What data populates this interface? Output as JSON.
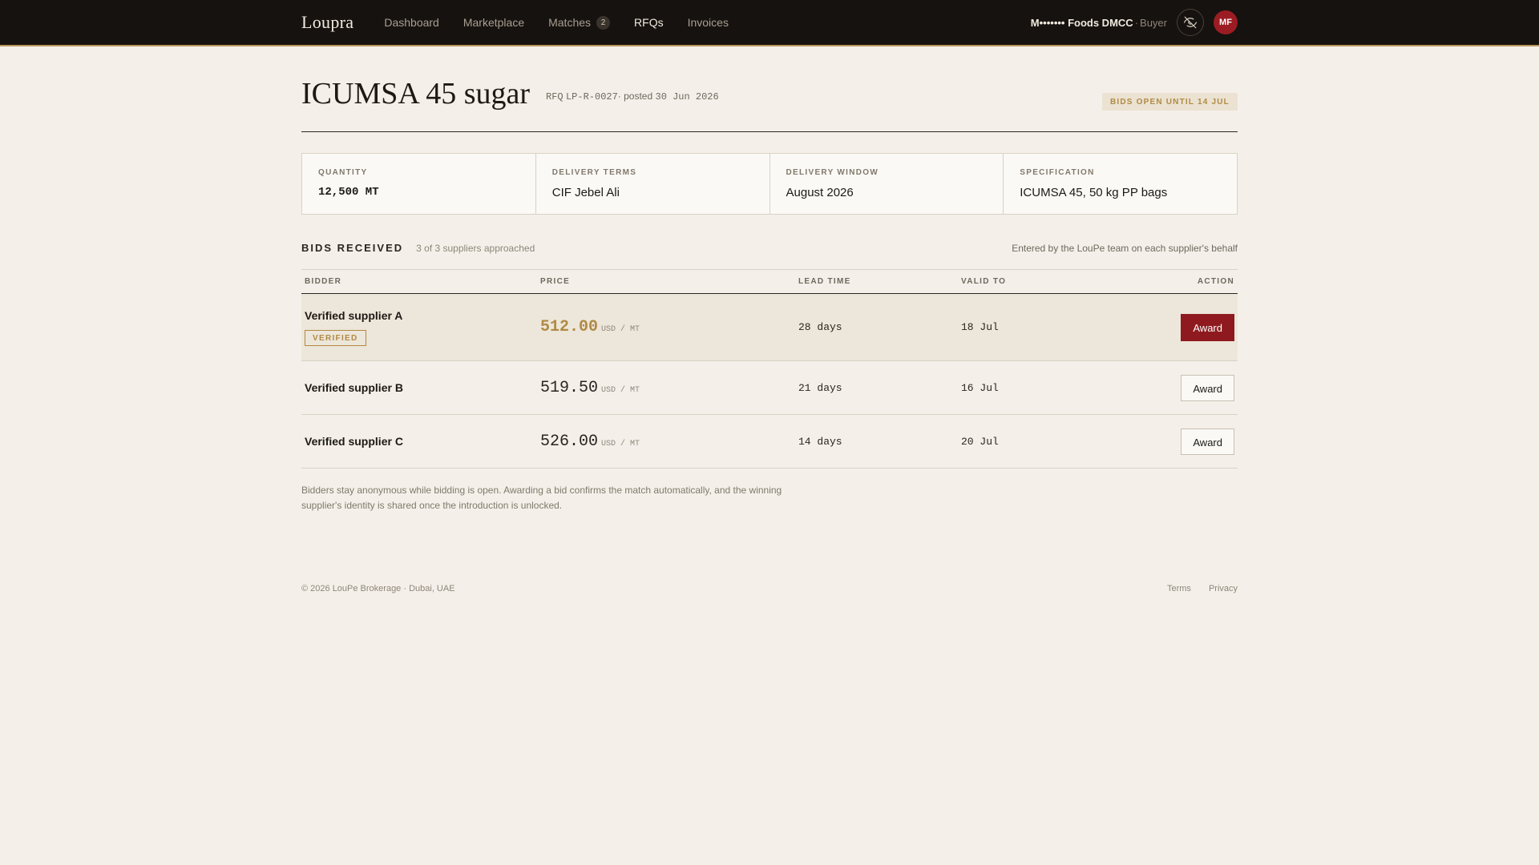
{
  "nav": {
    "brand": "Loupra",
    "items": [
      {
        "label": "Dashboard"
      },
      {
        "label": "Marketplace"
      },
      {
        "label": "Matches",
        "badge": "2"
      },
      {
        "label": "RFQs",
        "active": true
      },
      {
        "label": "Invoices"
      }
    ],
    "account_name": "M••••••• Foods DMCC",
    "account_sep": "·",
    "account_role": "Buyer",
    "privacy_icon": "eye-off-icon",
    "avatar_initials": "MF"
  },
  "rfq": {
    "title": "ICUMSA 45 sugar",
    "ref_prefix": "RFQ",
    "ref": "LP-R-0027",
    "posted_label": "· posted",
    "posted_date": "30 Jun 2026",
    "status": "BIDS OPEN UNTIL 14 JUL"
  },
  "specs": [
    {
      "label": "QUANTITY",
      "value": "12,500 MT",
      "mono": true
    },
    {
      "label": "DELIVERY TERMS",
      "value": "CIF Jebel Ali"
    },
    {
      "label": "DELIVERY WINDOW",
      "value": "August 2026"
    },
    {
      "label": "SPECIFICATION",
      "value": "ICUMSA 45, 50 kg PP bags"
    }
  ],
  "bids": {
    "title": "BIDS RECEIVED",
    "subtitle": "3 of 3 suppliers approached",
    "note": "Entered by the LouPe team on each supplier's behalf",
    "columns": {
      "bidder": "BIDDER",
      "price": "PRICE",
      "lead": "LEAD TIME",
      "valid": "VALID TO",
      "action": "ACTION"
    },
    "unit": "USD / MT",
    "award_label": "Award",
    "verified_label": "VERIFIED",
    "rows": [
      {
        "bidder": "Verified supplier A",
        "price": "512.00",
        "lead": "28 days",
        "valid": "18 Jul"
      },
      {
        "bidder": "Verified supplier B",
        "price": "519.50",
        "lead": "21 days",
        "valid": "16 Jul"
      },
      {
        "bidder": "Verified supplier C",
        "price": "526.00",
        "lead": "14 days",
        "valid": "20 Jul"
      }
    ],
    "footnote": "Bidders stay anonymous while bidding is open. Awarding a bid confirms the match automatically, and the winning supplier's identity is shared once the introduction is unlocked."
  },
  "footer": {
    "copyright": "© 2026 LouPe Brokerage · Dubai, UAE",
    "terms": "Terms",
    "privacy": "Privacy"
  },
  "colors": {
    "accent_gold": "#b08a44",
    "award_red": "#8e1a1f",
    "topbar": "#16120f",
    "background": "#f4f0e9"
  }
}
